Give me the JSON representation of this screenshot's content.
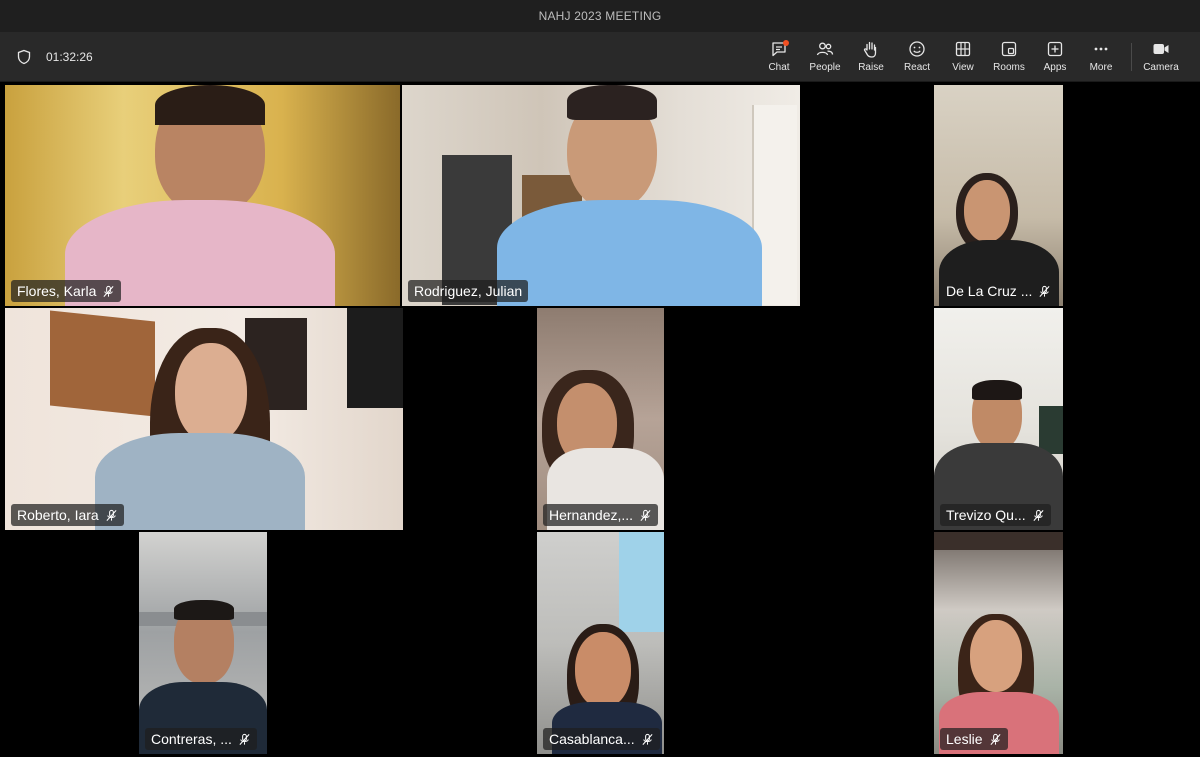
{
  "window": {
    "title": "NAHJ 2023 MEETING"
  },
  "toolbar": {
    "timer": "01:32:26",
    "buttons": [
      {
        "label": "Chat",
        "icon": "chat-icon",
        "notification": true
      },
      {
        "label": "People",
        "icon": "people-icon"
      },
      {
        "label": "Raise",
        "icon": "raise-hand-icon"
      },
      {
        "label": "React",
        "icon": "react-icon"
      },
      {
        "label": "View",
        "icon": "view-grid-icon"
      },
      {
        "label": "Rooms",
        "icon": "rooms-icon"
      },
      {
        "label": "Apps",
        "icon": "apps-icon"
      },
      {
        "label": "More",
        "icon": "more-icon"
      },
      {
        "label": "Camera",
        "icon": "camera-icon"
      }
    ]
  },
  "participants": [
    {
      "name": "Flores, Karla",
      "muted": true
    },
    {
      "name": "Rodriguez, Julian",
      "muted": false
    },
    {
      "name": "De La Cruz ...",
      "muted": true
    },
    {
      "name": "Roberto, Iara",
      "muted": true
    },
    {
      "name": "Hernandez,...",
      "muted": true
    },
    {
      "name": "Trevizo Qu...",
      "muted": true
    },
    {
      "name": "Contreras, ...",
      "muted": true
    },
    {
      "name": "Casablanca...",
      "muted": true
    },
    {
      "name": "Leslie",
      "muted": true
    }
  ],
  "colors": {
    "notification_dot": "#f25022",
    "toolbar_bg": "#292929",
    "titlebar_bg": "#1f1f1f"
  }
}
